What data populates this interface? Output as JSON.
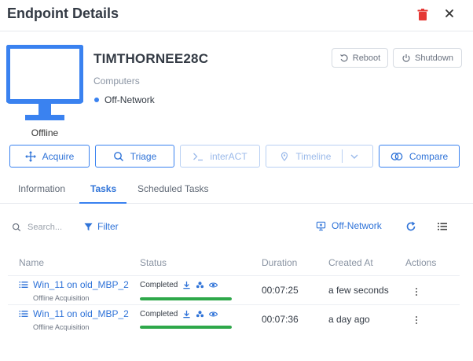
{
  "header": {
    "title": "Endpoint Details"
  },
  "endpoint": {
    "hostname": "TIMTHORNEE28C",
    "group": "Computers",
    "network_status": "Off-Network",
    "state_label": "Offline"
  },
  "system_actions": {
    "reboot_label": "Reboot",
    "shutdown_label": "Shutdown"
  },
  "actions": {
    "acquire_label": "Acquire",
    "triage_label": "Triage",
    "interact_label": "interACT",
    "timeline_label": "Timeline",
    "compare_label": "Compare"
  },
  "tabs": [
    {
      "label": "Information"
    },
    {
      "label": "Tasks"
    },
    {
      "label": "Scheduled Tasks"
    }
  ],
  "toolbar": {
    "search_placeholder": "Search...",
    "filter_label": "Filter",
    "network_filter_label": "Off-Network"
  },
  "table": {
    "headers": [
      "Name",
      "Status",
      "Duration",
      "Created At",
      "Actions"
    ],
    "rows": [
      {
        "name": "Win_11 on old_MBP_2",
        "type": "Offline Acquisition",
        "status": "Completed",
        "progress": 1.0,
        "duration": "00:07:25",
        "created": "a few seconds"
      },
      {
        "name": "Win_11 on old_MBP_2",
        "type": "Offline Acquisition",
        "status": "Completed",
        "progress": 1.0,
        "duration": "00:07:36",
        "created": "a day ago"
      }
    ]
  },
  "colors": {
    "accent": "#3a82f0",
    "success": "#2ea84a",
    "danger": "#e53935"
  }
}
